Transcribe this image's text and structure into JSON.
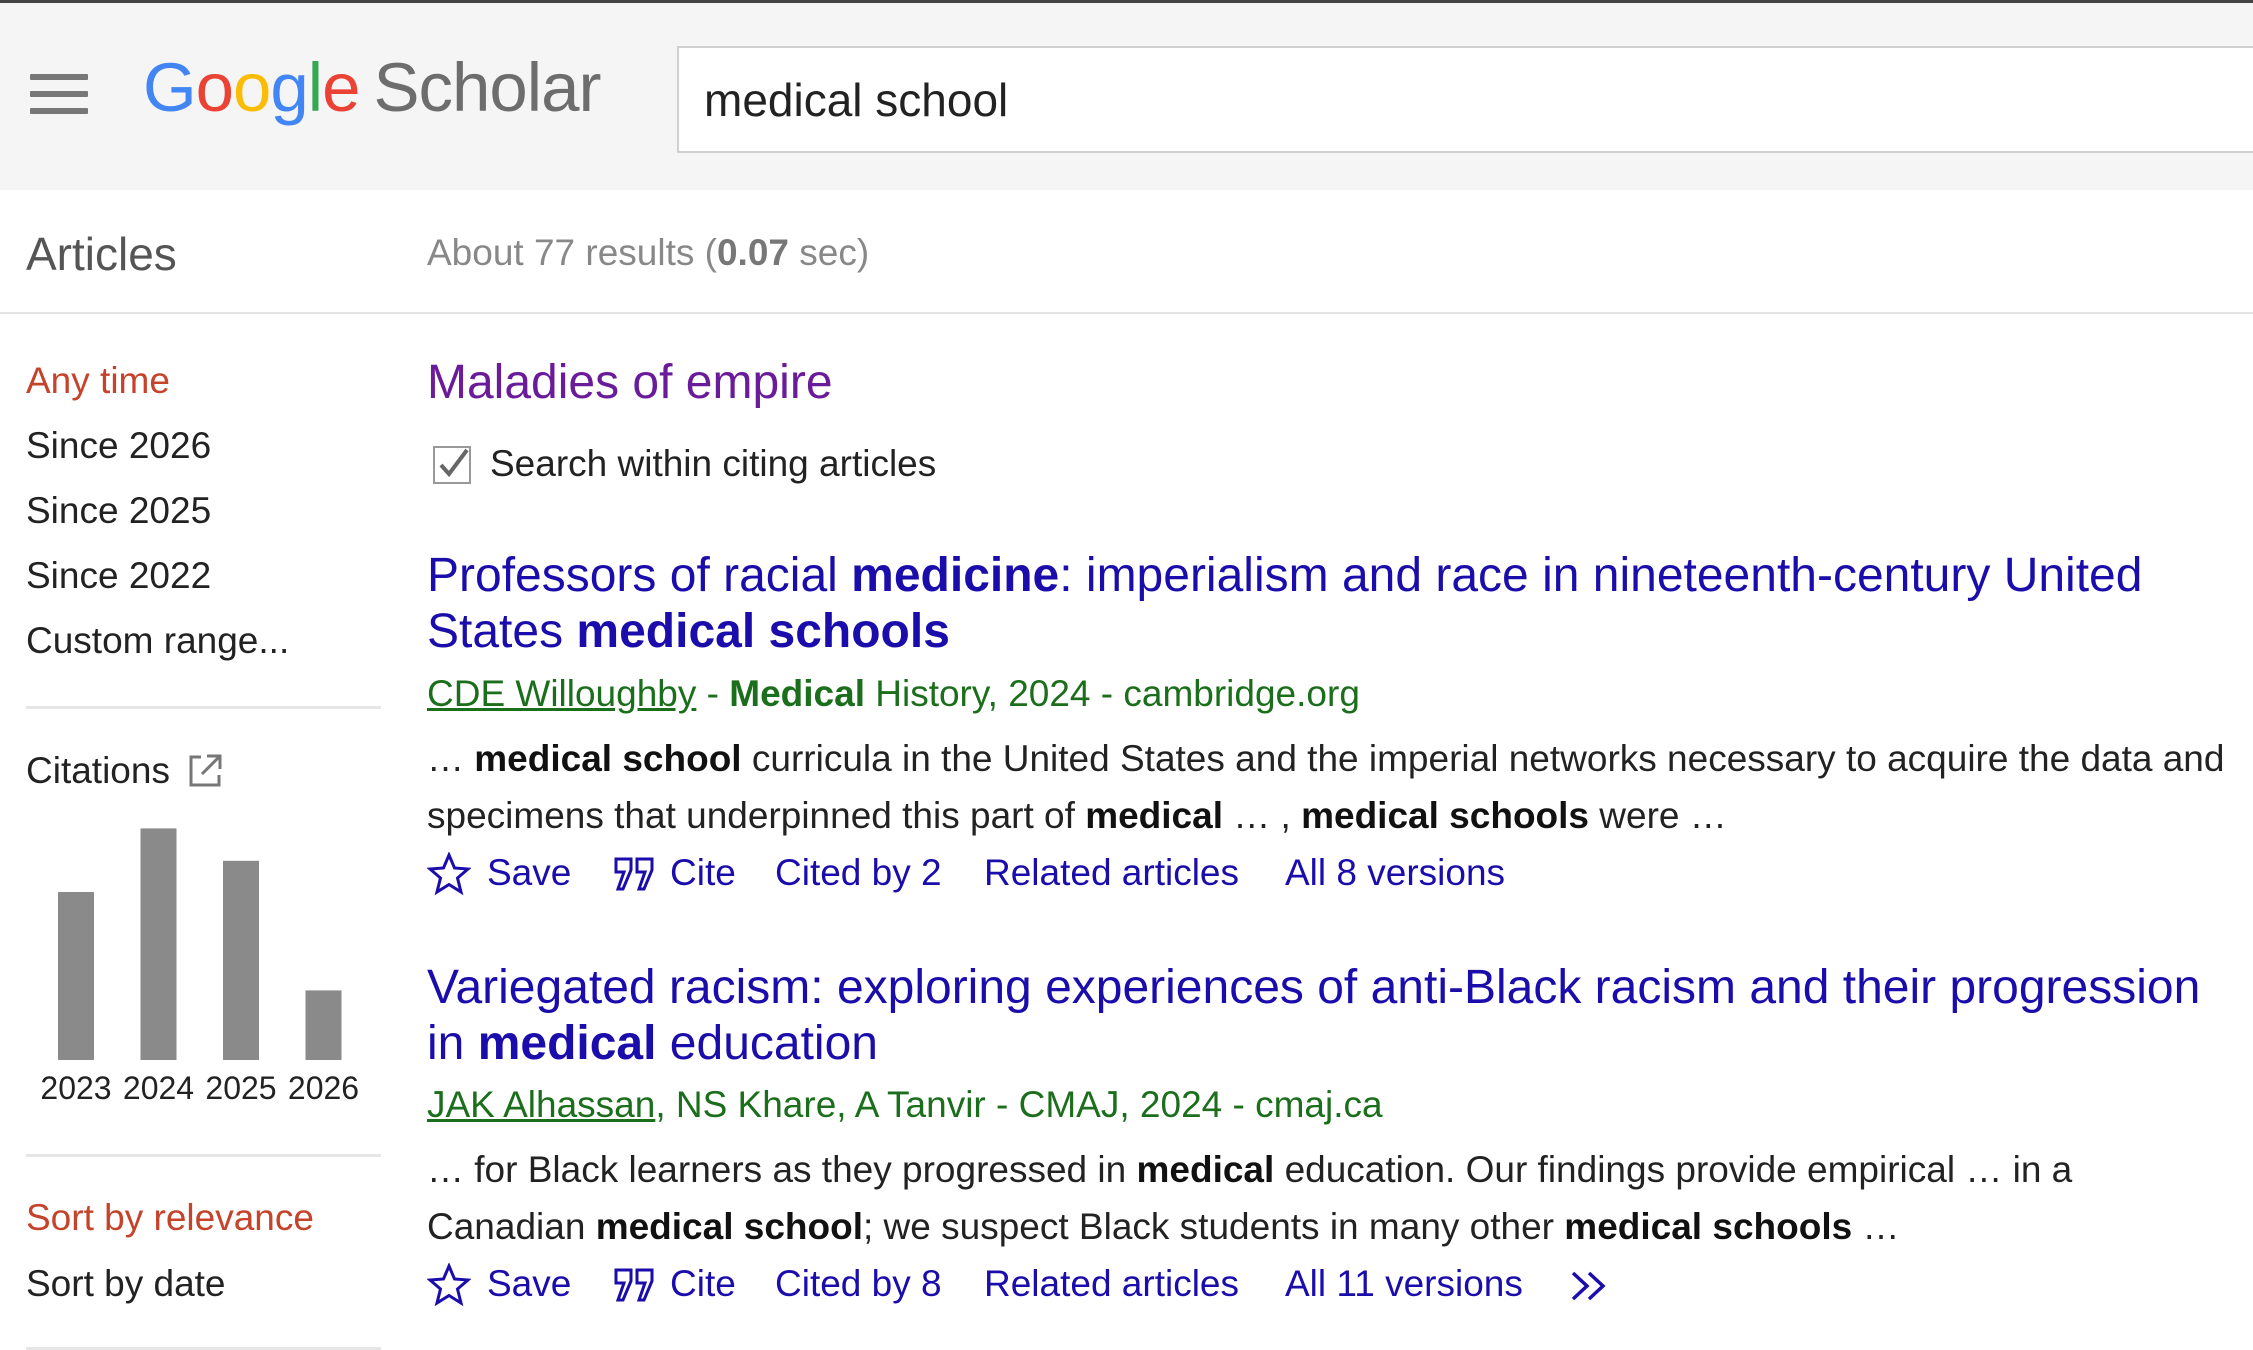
{
  "header": {
    "logo_letters": [
      {
        "ch": "G",
        "color": "#4285f4"
      },
      {
        "ch": "o",
        "color": "#ea4335"
      },
      {
        "ch": "o",
        "color": "#fbbc05"
      },
      {
        "ch": "g",
        "color": "#4285f4"
      },
      {
        "ch": "l",
        "color": "#34a853"
      },
      {
        "ch": "e",
        "color": "#ea4335"
      }
    ],
    "logo_suffix": "Scholar",
    "menu_icon": "hamburger-menu-icon",
    "search_value": "medical school"
  },
  "subbar": {
    "section_label": "Articles",
    "stats_prefix": "About 77 results (",
    "stats_time": "0.07",
    "stats_suffix": " sec)"
  },
  "sidebar": {
    "time_filters": [
      "Any time",
      "Since 2026",
      "Since 2025",
      "Since 2022",
      "Custom range..."
    ],
    "active_time_filter": "Any time",
    "citations_label": "Citations",
    "citations_icon": "external-link-icon",
    "sort_options": [
      "Sort by relevance",
      "Sort by date"
    ],
    "active_sort": "Sort by relevance"
  },
  "chart_data": {
    "type": "bar",
    "categories": [
      "2023",
      "2024",
      "2025",
      "2026"
    ],
    "values": [
      14,
      19.3,
      16.6,
      5.8
    ],
    "ylim": [
      0,
      20
    ],
    "bar_color": "#8a8a8a",
    "grid": false,
    "title": "",
    "xlabel": "",
    "ylabel": ""
  },
  "citing": {
    "title": "Maladies of empire",
    "checkbox_label": "Search within citing articles",
    "checked": true
  },
  "results": [
    {
      "title_parts": [
        {
          "t": "Professors of racial ",
          "b": false
        },
        {
          "t": "medicine",
          "b": true
        },
        {
          "t": ": imperialism and race in nineteenth-century United States ",
          "b": false
        },
        {
          "t": "medical schools",
          "b": true
        }
      ],
      "meta_parts": [
        {
          "t": "CDE Willoughby",
          "u": true,
          "b": false
        },
        {
          "t": " - ",
          "u": false,
          "b": false
        },
        {
          "t": "Medical",
          "u": false,
          "b": true
        },
        {
          "t": " History, 2024 - cambridge.org",
          "u": false,
          "b": false
        }
      ],
      "snippet_parts": [
        {
          "t": "… ",
          "b": false
        },
        {
          "t": "medical school",
          "b": true
        },
        {
          "t": " curricula in the United States and the imperial networks necessary to acquire the data and specimens that underpinned this part of ",
          "b": false
        },
        {
          "t": "medical",
          "b": true
        },
        {
          "t": " … , ",
          "b": false
        },
        {
          "t": "medical schools",
          "b": true
        },
        {
          "t": " were …",
          "b": false
        }
      ],
      "actions": {
        "save": "Save",
        "cite": "Cite",
        "cited_by": "Cited by 2",
        "related": "Related articles",
        "versions": "All 8 versions"
      }
    },
    {
      "title_parts": [
        {
          "t": "Variegated racism: exploring experiences of anti-Black racism and their progression in ",
          "b": false
        },
        {
          "t": "medical",
          "b": true
        },
        {
          "t": " education",
          "b": false
        }
      ],
      "meta_parts": [
        {
          "t": "JAK Alhassan",
          "u": true,
          "b": false
        },
        {
          "t": ", NS Khare, A Tanvir - CMAJ, 2024 - cmaj.ca",
          "u": false,
          "b": false
        }
      ],
      "snippet_parts": [
        {
          "t": "… for Black learners as they progressed in ",
          "b": false
        },
        {
          "t": "medical",
          "b": true
        },
        {
          "t": " education. Our findings provide empirical … in a Canadian ",
          "b": false
        },
        {
          "t": "medical school",
          "b": true
        },
        {
          "t": "; we suspect Black students in many other ",
          "b": false
        },
        {
          "t": "medical schools",
          "b": true
        },
        {
          "t": " …",
          "b": false
        }
      ],
      "actions": {
        "save": "Save",
        "cite": "Cite",
        "cited_by": "Cited by 8",
        "related": "Related articles",
        "versions": "All 11 versions",
        "more_icon": "double-chevron-right-icon"
      }
    }
  ]
}
